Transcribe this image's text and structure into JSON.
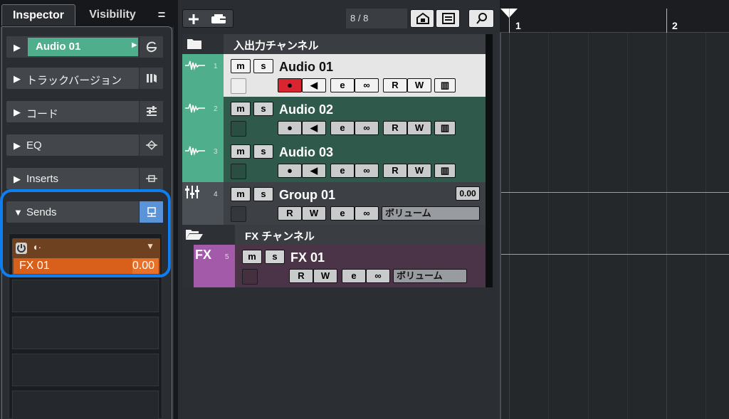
{
  "inspector": {
    "tab_inspector": "Inspector",
    "tab_visibility": "Visibility",
    "tab_menu": "=",
    "track_name": "Audio 01",
    "sections": {
      "track_versions": "トラックバージョン",
      "chords": "コード",
      "eq": "EQ",
      "inserts": "Inserts",
      "sends": "Sends"
    },
    "send": {
      "destination": "FX 01",
      "value": "0.00",
      "level_fraction": 0.82
    }
  },
  "toolbar": {
    "track_count": "8 / 8"
  },
  "tracks": [
    {
      "type": "folder",
      "name": "入出力チャンネル"
    },
    {
      "type": "audio",
      "number": "1",
      "name": "Audio 01",
      "selected": true
    },
    {
      "type": "audio",
      "number": "2",
      "name": "Audio 02"
    },
    {
      "type": "audio",
      "number": "3",
      "name": "Audio 03"
    },
    {
      "type": "group",
      "number": "4",
      "name": "Group 01",
      "value": "0.00",
      "automation_param": "ボリューム"
    },
    {
      "type": "folder",
      "name": "FX チャンネル"
    },
    {
      "type": "fx",
      "number": "5",
      "name": "FX 01",
      "badge": "FX",
      "automation_param": "ボリューム"
    }
  ],
  "buttons": {
    "mute": "m",
    "solo": "s",
    "read": "R",
    "write": "W"
  },
  "ruler": {
    "bars": [
      "1",
      "2"
    ]
  },
  "colors": {
    "audio_track": "#4fae8b",
    "audio_track_body": "#2f5a4b",
    "group_track": "#4b5056",
    "fx_track": "#a35aa8",
    "fx_track_body": "#4b3448",
    "send_slot": "#e8712a",
    "highlight": "#0e7ef0",
    "record": "#d9252f"
  }
}
